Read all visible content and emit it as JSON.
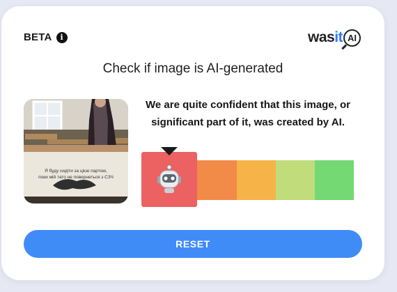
{
  "header": {
    "beta_label": "BETA",
    "info_icon": "i",
    "logo_prefix": "was",
    "logo_it": "it",
    "logo_ai": "AI"
  },
  "main": {
    "title": "Check if image is AI-generated",
    "verdict_line1": "We are quite confident that this image, or",
    "verdict_line2": "significant part of it, was created by AI.",
    "photo_caption_line1": "Я буду сидіти за цією партою,",
    "photo_caption_line2": "поки мій тато не повернеться з СЗЧ"
  },
  "scale": {
    "selected_level": 1,
    "levels": 5,
    "colors": [
      "#ec6161",
      "#f28a48",
      "#f6b347",
      "#c0dc7b",
      "#74d873"
    ],
    "selected_icon": "robot-icon"
  },
  "actions": {
    "reset_label": "RESET"
  }
}
